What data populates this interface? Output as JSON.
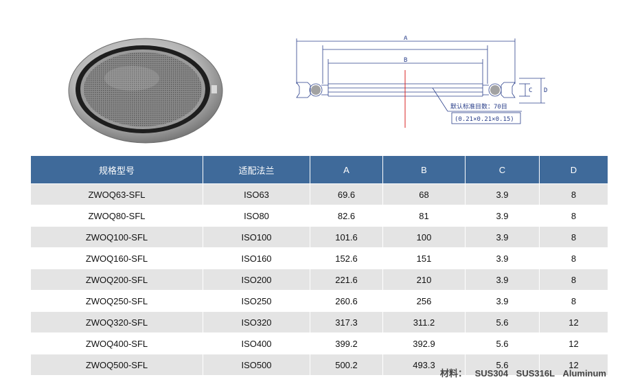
{
  "drawing": {
    "label_a": "A",
    "label_b": "B",
    "label_c": "C",
    "label_d": "D",
    "note_line1": "默认标准目数：70目",
    "note_line2": "(0.21×0.21×0.15)"
  },
  "table": {
    "headers": [
      "规格型号",
      "适配法兰",
      "A",
      "B",
      "C",
      "D"
    ],
    "rows": [
      [
        "ZWOQ63-SFL",
        "ISO63",
        "69.6",
        "68",
        "3.9",
        "8"
      ],
      [
        "ZWOQ80-SFL",
        "ISO80",
        "82.6",
        "81",
        "3.9",
        "8"
      ],
      [
        "ZWOQ100-SFL",
        "ISO100",
        "101.6",
        "100",
        "3.9",
        "8"
      ],
      [
        "ZWOQ160-SFL",
        "ISO160",
        "152.6",
        "151",
        "3.9",
        "8"
      ],
      [
        "ZWOQ200-SFL",
        "ISO200",
        "221.6",
        "210",
        "3.9",
        "8"
      ],
      [
        "ZWOQ250-SFL",
        "ISO250",
        "260.6",
        "256",
        "3.9",
        "8"
      ],
      [
        "ZWOQ320-SFL",
        "ISO320",
        "317.3",
        "311.2",
        "5.6",
        "12"
      ],
      [
        "ZWOQ400-SFL",
        "ISO400",
        "399.2",
        "392.9",
        "5.6",
        "12"
      ],
      [
        "ZWOQ500-SFL",
        "ISO500",
        "500.2",
        "493.3",
        "5.6",
        "12"
      ]
    ]
  },
  "material": {
    "label": "材料：",
    "values": [
      "SUS304",
      "SUS316L",
      "Aluminum"
    ]
  }
}
